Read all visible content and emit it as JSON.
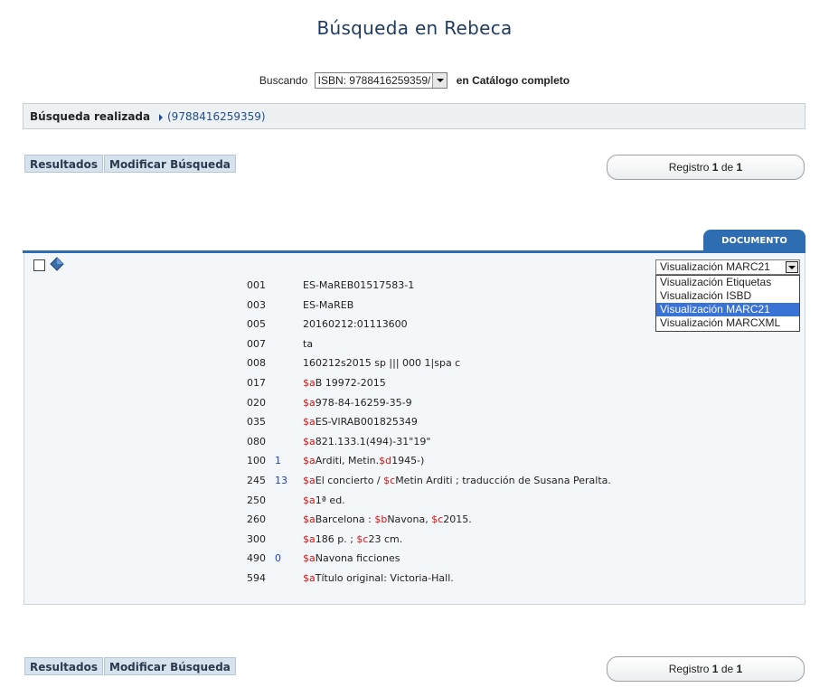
{
  "page": {
    "title": "Búsqueda en Rebeca"
  },
  "search": {
    "label": "Buscando",
    "value": "ISBN: 9788416259359/",
    "scope": "en Catálogo completo"
  },
  "realizada": {
    "label": "Búsqueda realizada",
    "query": "(9788416259359)"
  },
  "buttons": {
    "results": "Resultados",
    "modify": "Modificar Búsqueda"
  },
  "registro": {
    "prefix": "Registro",
    "current": "1",
    "of": "de",
    "total": "1"
  },
  "tab": {
    "label": "DOCUMENTO"
  },
  "view_select": {
    "selected": "Visualización MARC21",
    "options": [
      "Visualización Etiquetas",
      "Visualización ISBD",
      "Visualización MARC21",
      "Visualización MARCXML"
    ],
    "highlighted_index": 2
  },
  "marc": [
    {
      "tag": "001",
      "ind": "",
      "parts": [
        [
          "",
          "ES-MaREB01517583-1"
        ]
      ]
    },
    {
      "tag": "003",
      "ind": "",
      "parts": [
        [
          "",
          "ES-MaREB"
        ]
      ]
    },
    {
      "tag": "005",
      "ind": "",
      "parts": [
        [
          "",
          "20160212:01113600"
        ]
      ]
    },
    {
      "tag": "007",
      "ind": "",
      "parts": [
        [
          "",
          "ta"
        ]
      ]
    },
    {
      "tag": "008",
      "ind": "",
      "parts": [
        [
          "",
          "160212s2015 sp ||| 000 1|spa c"
        ]
      ]
    },
    {
      "tag": "017",
      "ind": "",
      "parts": [
        [
          "$a",
          "B 19972-2015"
        ]
      ]
    },
    {
      "tag": "020",
      "ind": "",
      "parts": [
        [
          "$a",
          "978-84-16259-35-9"
        ]
      ]
    },
    {
      "tag": "035",
      "ind": "",
      "parts": [
        [
          "$a",
          "ES-VlRAB001825349"
        ]
      ]
    },
    {
      "tag": "080",
      "ind": "",
      "parts": [
        [
          "$a",
          "821.133.1(494)-31\"19\""
        ]
      ]
    },
    {
      "tag": "100",
      "ind": "1",
      "parts": [
        [
          "$a",
          "Arditi, Metin."
        ],
        [
          "$d",
          "1945-)"
        ]
      ]
    },
    {
      "tag": "245",
      "ind": "13",
      "parts": [
        [
          "$a",
          "El concierto / "
        ],
        [
          "$c",
          "Metin Arditi ; traducción de Susana Peralta."
        ]
      ]
    },
    {
      "tag": "250",
      "ind": "",
      "parts": [
        [
          "$a",
          "1ª ed."
        ]
      ]
    },
    {
      "tag": "260",
      "ind": "",
      "parts": [
        [
          "$a",
          "Barcelona : "
        ],
        [
          "$b",
          "Navona, "
        ],
        [
          "$c",
          "2015."
        ]
      ]
    },
    {
      "tag": "300",
      "ind": "",
      "parts": [
        [
          "$a",
          "186 p. ; "
        ],
        [
          "$c",
          "23 cm."
        ]
      ]
    },
    {
      "tag": "490",
      "ind": "0",
      "parts": [
        [
          "$a",
          "Navona ficciones"
        ]
      ]
    },
    {
      "tag": "594",
      "ind": "",
      "parts": [
        [
          "$a",
          "Título original: Victoria-Hall."
        ]
      ]
    }
  ],
  "colors": {
    "accent": "#2f6db3",
    "subfield": "#dd1111",
    "indicator": "#1f3fbf"
  },
  "icons": {
    "checkbox": "checkbox-icon",
    "book": "book-icon"
  }
}
